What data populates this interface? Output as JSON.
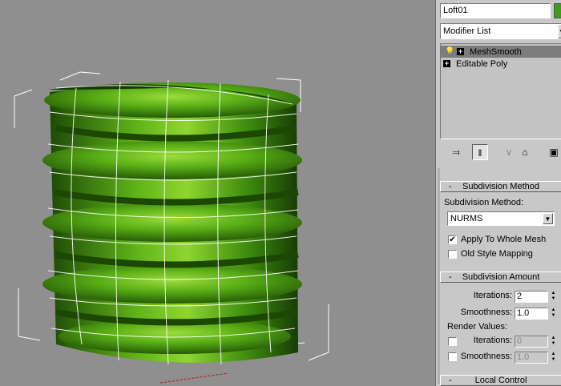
{
  "panel": {
    "object_name": "Loft01",
    "object_color": "#3e9c17",
    "modifier_list": {
      "label": "Modifier List"
    },
    "stack": [
      {
        "label": "MeshSmooth",
        "selected": true
      },
      {
        "label": "Editable Poly",
        "selected": false
      }
    ],
    "toolbar_icons": [
      "pin-stack-icon",
      "show-end-result-icon",
      "make-unique-icon",
      "remove-modifier-icon",
      "configure-modifier-sets-icon"
    ]
  },
  "subdivision_method": {
    "title": "Subdivision Method",
    "collapse_glyph": "-",
    "method_label": "Subdivision Method:",
    "method_value": "NURMS",
    "apply_to_whole_mesh": {
      "label": "Apply To Whole Mesh",
      "checked": true
    },
    "old_style_mapping": {
      "label": "Old Style Mapping",
      "checked": false
    }
  },
  "subdivision_amount": {
    "title": "Subdivision Amount",
    "collapse_glyph": "-",
    "iterations": {
      "label": "Iterations:",
      "value": "2"
    },
    "smoothness": {
      "label": "Smoothness:",
      "value": "1.0"
    },
    "render_values_label": "Render Values:",
    "render_iterations": {
      "label": "Iterations:",
      "value": "0",
      "checked": false
    },
    "render_smoothness": {
      "label": "Smoothness:",
      "value": "1.0",
      "checked": false
    }
  },
  "local_control": {
    "title": "Local Control",
    "collapse_glyph": "-"
  },
  "glyphs": {
    "check": "✔",
    "dropdown_arrow": "▼",
    "spin_up": "▲",
    "spin_down": "▼",
    "bulb": "💡",
    "plus": "+"
  },
  "viewport": {
    "mesh_color": "#4c9a12",
    "wire_color": "#ffffff",
    "bounding_box_color": "#ffffff"
  }
}
